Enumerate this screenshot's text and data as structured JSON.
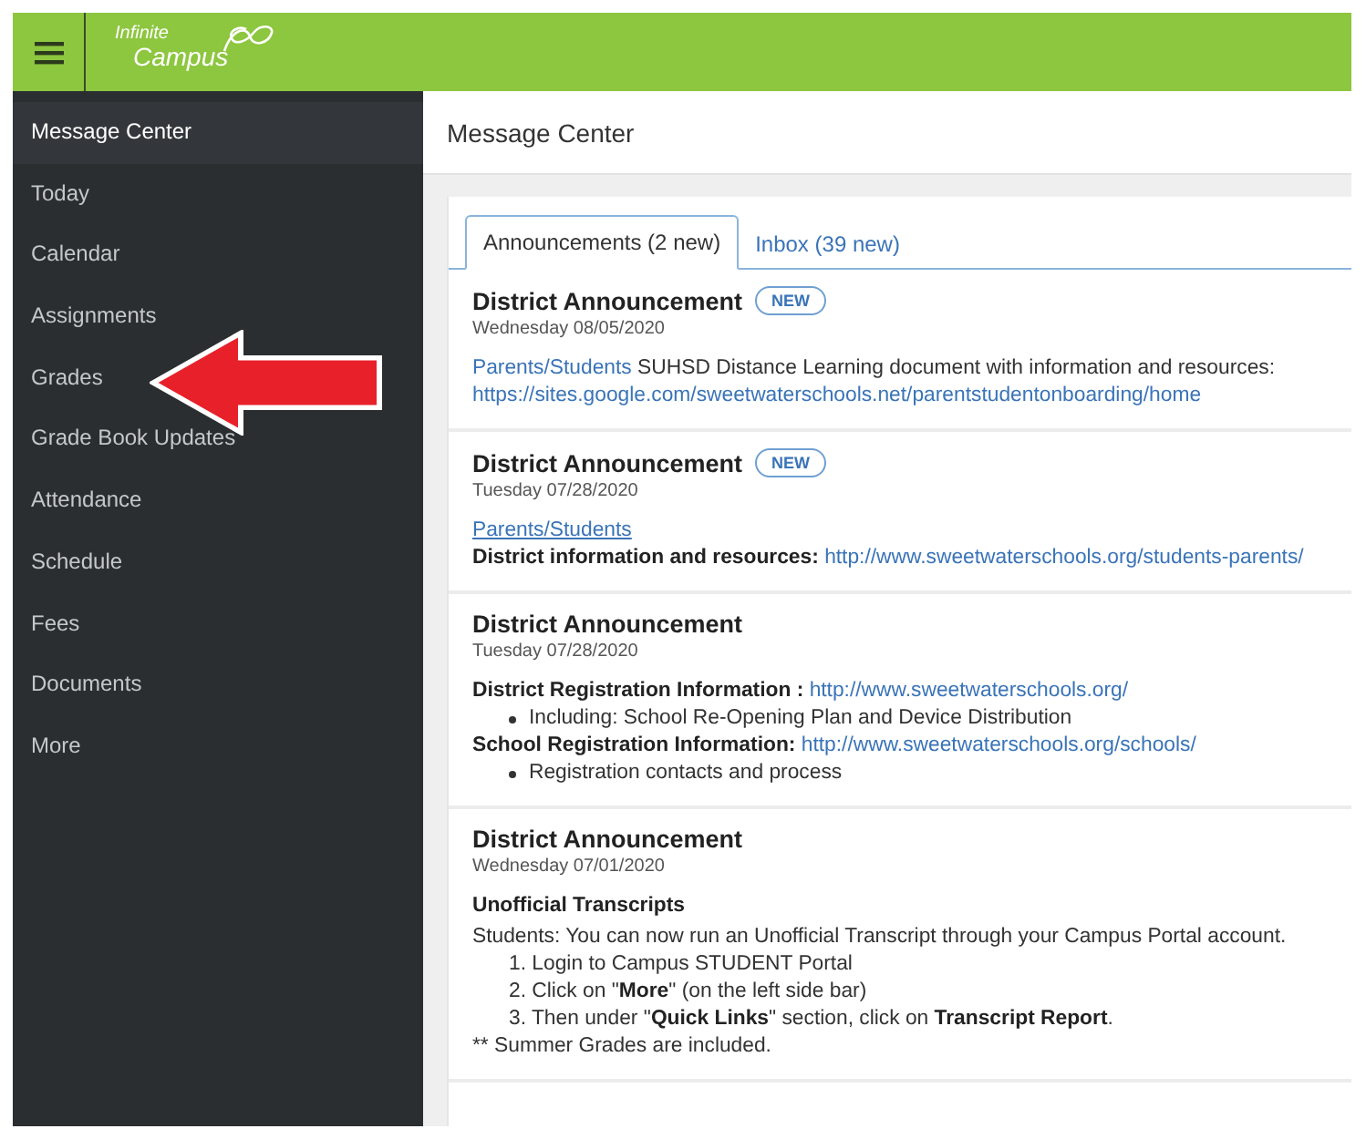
{
  "header": {
    "logo": {
      "line_1": "Infinite",
      "line_2": "Campus"
    }
  },
  "sidebar": {
    "items": [
      {
        "label": "Message Center",
        "selected": true
      },
      {
        "label": "Today",
        "selected": false
      },
      {
        "label": "Calendar",
        "selected": false
      },
      {
        "label": "Assignments",
        "selected": false
      },
      {
        "label": "Grades",
        "selected": false
      },
      {
        "label": "Grade Book Updates",
        "selected": false
      },
      {
        "label": "Attendance",
        "selected": false
      },
      {
        "label": "Schedule",
        "selected": false
      },
      {
        "label": "Fees",
        "selected": false
      },
      {
        "label": "Documents",
        "selected": false
      },
      {
        "label": "More",
        "selected": false
      }
    ]
  },
  "page_title": "Message Center",
  "tabs": [
    {
      "label": "Announcements (2 new)",
      "selected": true
    },
    {
      "label": "Inbox (39 new)",
      "selected": false
    }
  ],
  "announcements": [
    {
      "title": "District Announcement",
      "badge": "NEW",
      "date": "Wednesday 08/05/2020",
      "lines": [
        {
          "kind": "paragraph",
          "parts": [
            {
              "kind": "link",
              "text": "Parents/Students"
            },
            {
              "kind": "text",
              "text": " SUHSD Distance Learning document with information and resources: "
            },
            {
              "kind": "link",
              "text": "https://sites.google.com/sweetwaterschools.net/parentstudentonboarding/home"
            }
          ]
        }
      ]
    },
    {
      "title": "District Announcement",
      "badge": "NEW",
      "date": "Tuesday 07/28/2020",
      "lines": [
        {
          "kind": "paragraph",
          "parts": [
            {
              "kind": "underlined_link",
              "text": "Parents/Students"
            }
          ]
        },
        {
          "kind": "line",
          "parts": [
            {
              "kind": "text",
              "text": "**District information and resources:** "
            },
            {
              "kind": "link",
              "text": "http://www.sweetwaterschools.org/students-parents/"
            }
          ]
        }
      ]
    },
    {
      "title": "District Announcement",
      "date": "Tuesday 07/28/2020",
      "lines": [
        {
          "kind": "paragraph",
          "parts": [
            {
              "kind": "text",
              "text": "**District Registration Information :** "
            },
            {
              "kind": "link",
              "text": "http://www.sweetwaterschools.org/"
            }
          ]
        },
        {
          "kind": "bullet",
          "parts": [
            {
              "kind": "text",
              "text": "Including: School Re-Opening Plan and Device Distribution"
            }
          ]
        },
        {
          "kind": "line",
          "parts": [
            {
              "kind": "text",
              "text": "**School Registration Information:** "
            },
            {
              "kind": "link",
              "text": "http://www.sweetwaterschools.org/schools/"
            }
          ]
        },
        {
          "kind": "bullet",
          "parts": [
            {
              "kind": "text",
              "text": "Registration contacts and process"
            }
          ]
        }
      ]
    },
    {
      "title": "District Announcement",
      "date": "Wednesday 07/01/2020",
      "lines": [
        {
          "kind": "heading",
          "parts": [
            {
              "kind": "text",
              "text": "Unofficial Transcripts"
            }
          ]
        },
        {
          "kind": "line",
          "parts": [
            {
              "kind": "text",
              "text": "Students: You can now run an Unofficial Transcript through your Campus Portal account."
            }
          ]
        },
        {
          "kind": "numbered",
          "parts": [
            {
              "kind": "text",
              "text": "1. Login to Campus STUDENT Portal"
            }
          ]
        },
        {
          "kind": "numbered",
          "parts": [
            {
              "kind": "text",
              "text": "2. Click on \"**More**\" (on the left side bar)"
            }
          ]
        },
        {
          "kind": "numbered",
          "parts": [
            {
              "kind": "text",
              "text": "3. Then under \"**Quick Links**\" section, click on **Transcript Report**."
            }
          ]
        },
        {
          "kind": "line",
          "parts": [
            {
              "kind": "text",
              "text": "** Summer Grades are included."
            }
          ]
        }
      ]
    }
  ]
}
